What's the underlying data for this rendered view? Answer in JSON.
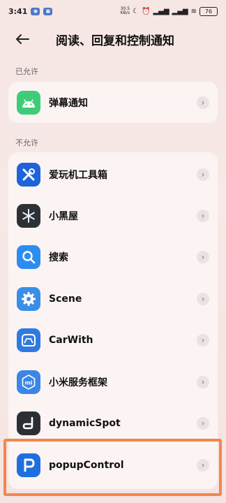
{
  "status_bar": {
    "time": "3:41",
    "net_speed": "30.5\nKB/s",
    "battery": "76"
  },
  "header": {
    "title": "阅读、回复和控制通知"
  },
  "sections": {
    "allowed_label": "已允许",
    "not_allowed_label": "不允许"
  },
  "allowed_apps": [
    {
      "name": "弹幕通知",
      "icon": "android-icon",
      "color": "#3ecc78"
    }
  ],
  "not_allowed_apps": [
    {
      "name": "爱玩机工具箱",
      "icon": "tools-icon",
      "color": "#1e63d8"
    },
    {
      "name": "小黑屋",
      "icon": "snowflake-icon",
      "color": "#2d3136"
    },
    {
      "name": "搜索",
      "icon": "search-icon",
      "color": "#2d8cf0"
    },
    {
      "name": "Scene",
      "icon": "gear-icon",
      "color": "#3a8ee8"
    },
    {
      "name": "CarWith",
      "icon": "car-icon",
      "color": "#2f7ae0"
    },
    {
      "name": "小米服务框架",
      "icon": "mi-icon",
      "color": "#3c86e6"
    },
    {
      "name": "dynamicSpot",
      "icon": "dynamicspot-icon",
      "color": "#2b2f35"
    },
    {
      "name": "popupControl",
      "icon": "popup-p-icon",
      "color": "#1f6fe0"
    }
  ],
  "highlight_color": "#f2864f"
}
